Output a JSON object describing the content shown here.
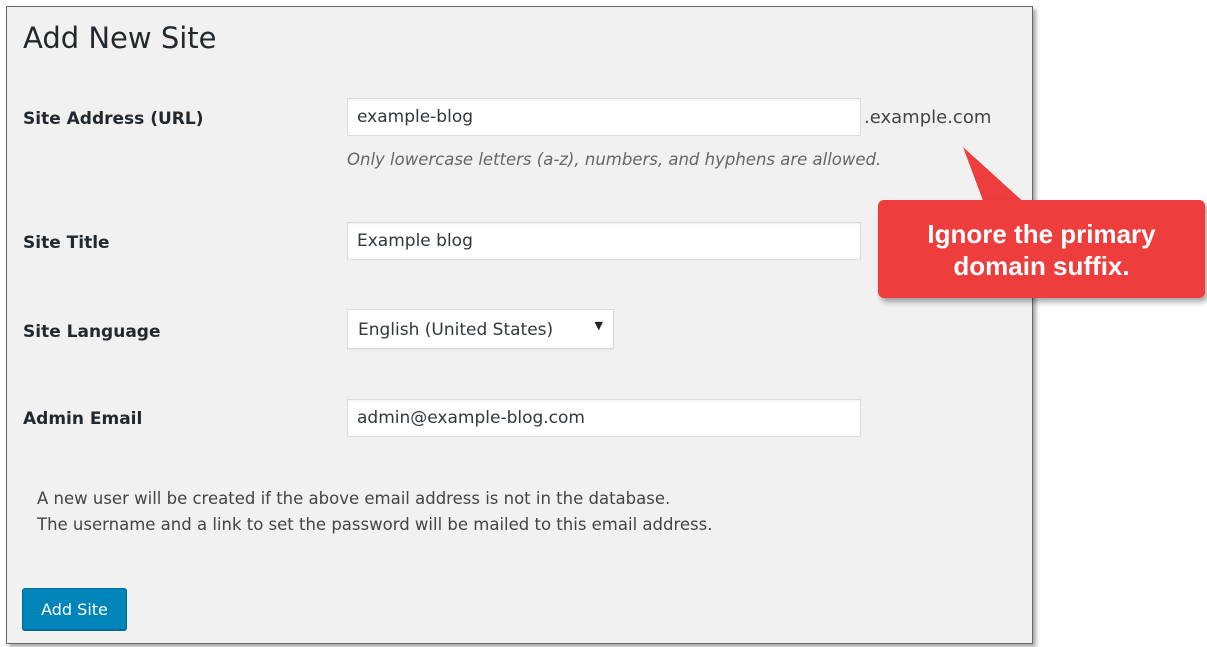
{
  "page": {
    "title": "Add New Site"
  },
  "form": {
    "site_address": {
      "label": "Site Address (URL)",
      "value": "example-blog",
      "suffix": ".example.com",
      "hint": "Only lowercase letters (a-z), numbers, and hyphens are allowed."
    },
    "site_title": {
      "label": "Site Title",
      "value": "Example blog"
    },
    "site_language": {
      "label": "Site Language",
      "selected": "English (United States)"
    },
    "admin_email": {
      "label": "Admin Email",
      "value": "admin@example-blog.com"
    },
    "note_line_1": "A new user will be created if the above email address is not in the database.",
    "note_line_2": "The username and a link to set the password will be mailed to this email address.",
    "submit_label": "Add Site"
  },
  "callout": {
    "text": "Ignore the primary domain suffix.",
    "color": "#ee3d3d"
  },
  "colors": {
    "button": "#0085ba",
    "panel_background": "#f1f1f1"
  }
}
